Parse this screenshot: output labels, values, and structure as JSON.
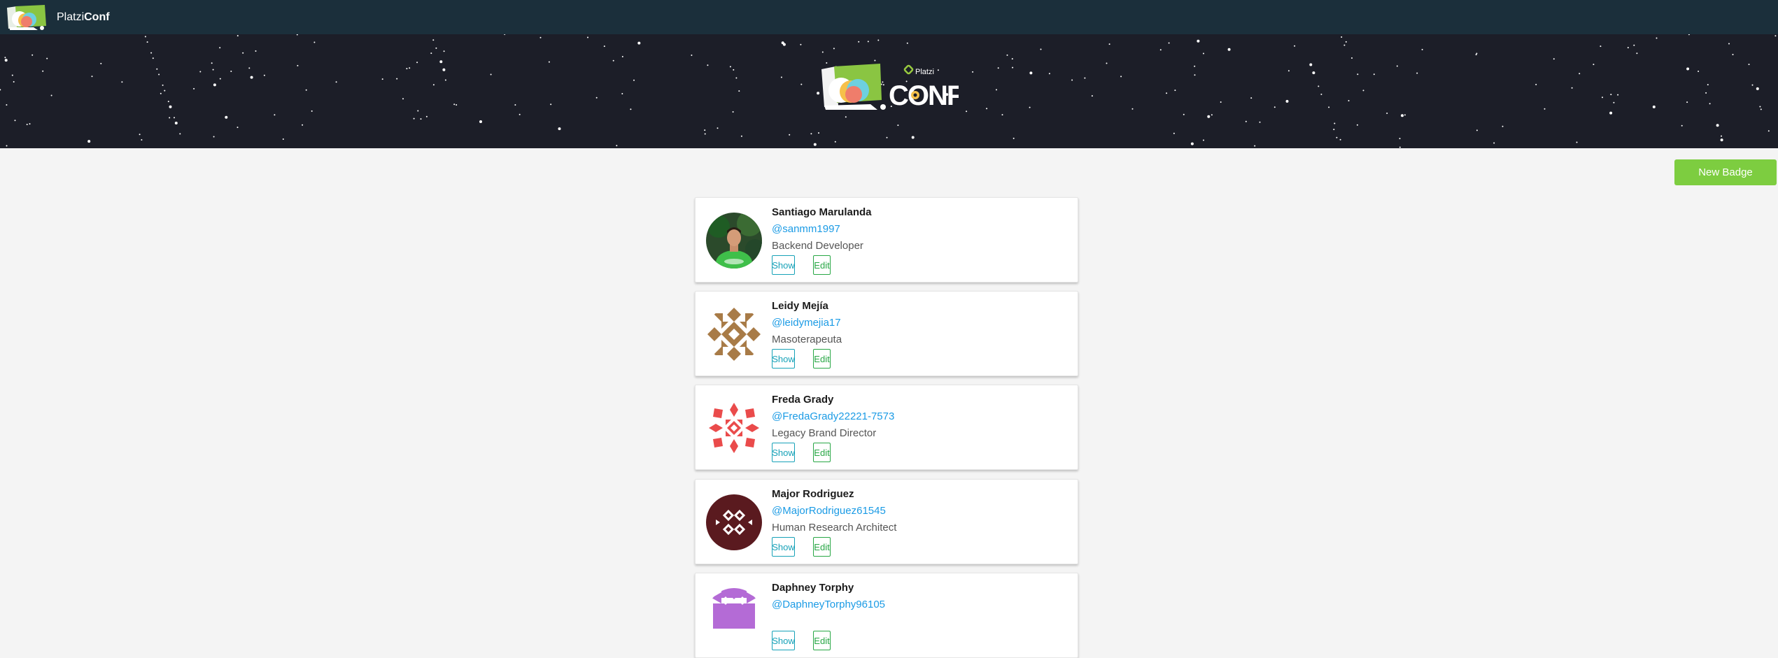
{
  "navbar": {
    "brand_light": "Platzi",
    "brand_bold": "Conf"
  },
  "hero": {
    "logo_small": "Platzi",
    "logo_big": "CONF"
  },
  "actions": {
    "new_badge_label": "New Badge"
  },
  "colors": {
    "navbar_bg": "#1b2f3b",
    "hero_bg": "#1c1e28",
    "page_bg": "#f4f4f4",
    "accent_green": "#7dcd40",
    "link_blue": "#1b9be5",
    "show_btn": "#17a2b8",
    "edit_btn": "#28a745"
  },
  "badges": [
    {
      "name": "Santiago Marulanda",
      "handle": "@sanmm1997",
      "job": "Backend Developer",
      "show_label": "Show",
      "edit_label": "Edit",
      "avatar": "photo-avatar"
    },
    {
      "name": "Leidy Mejía",
      "handle": "@leidymejia17",
      "job": "Masoterapeuta",
      "show_label": "Show",
      "edit_label": "Edit",
      "avatar": "identicon-brown"
    },
    {
      "name": "Freda Grady",
      "handle": "@FredaGrady22221-7573",
      "job": "Legacy Brand Director",
      "show_label": "Show",
      "edit_label": "Edit",
      "avatar": "identicon-red"
    },
    {
      "name": "Major Rodriguez",
      "handle": "@MajorRodriguez61545",
      "job": "Human Research Architect",
      "show_label": "Show",
      "edit_label": "Edit",
      "avatar": "identicon-maroon"
    },
    {
      "name": "Daphney Torphy",
      "handle": "@DaphneyTorphy96105",
      "job": "",
      "show_label": "Show",
      "edit_label": "Edit",
      "avatar": "identicon-purple"
    }
  ]
}
